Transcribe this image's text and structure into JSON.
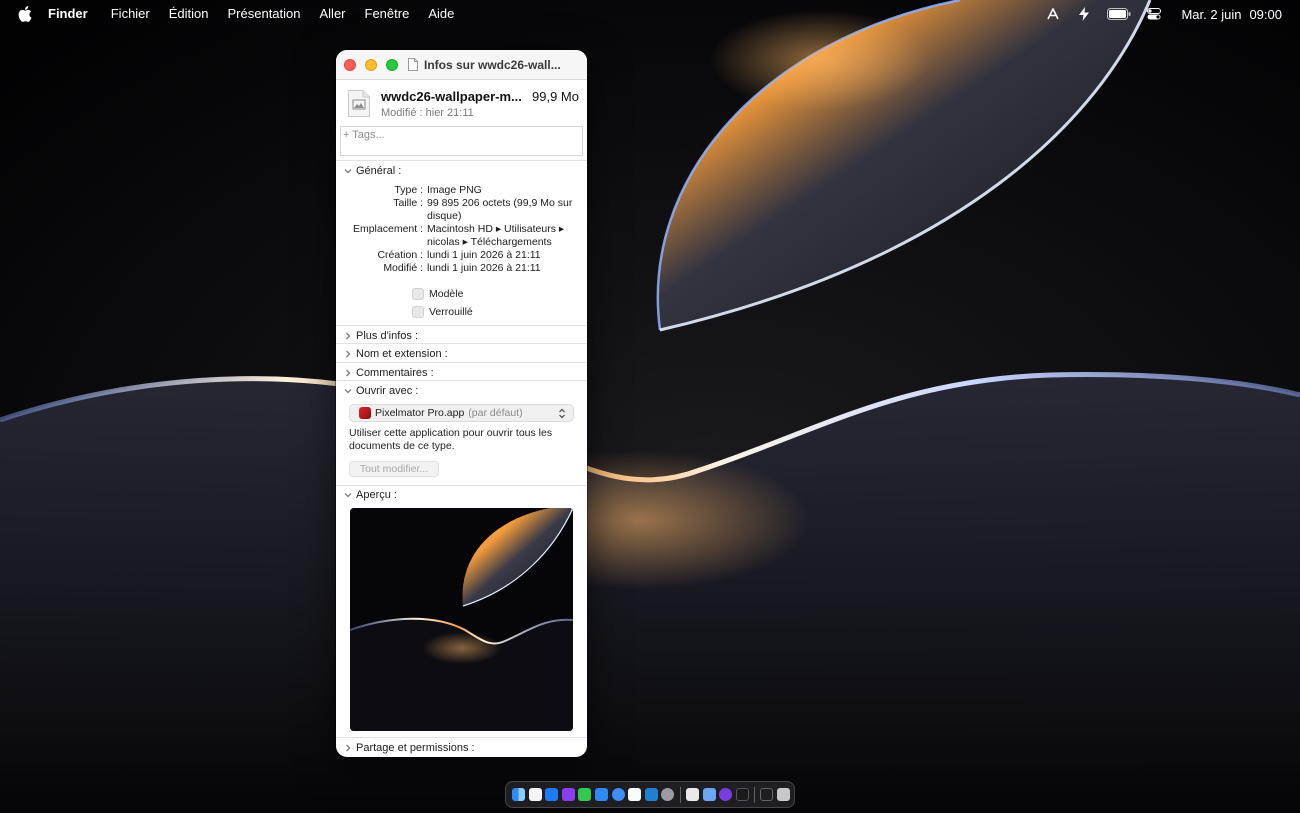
{
  "menubar": {
    "app_name": "Finder",
    "items": [
      "Fichier",
      "Édition",
      "Présentation",
      "Aller",
      "Fenêtre",
      "Aide"
    ],
    "status_icons": [
      "font-icon",
      "bolt-icon",
      "battery-icon",
      "control-center-icon"
    ],
    "date": "Mar. 2 juin",
    "time": "09:00"
  },
  "window": {
    "title": "Infos sur wwdc26-wall...",
    "file_name": "wwdc26-wallpaper-m...",
    "file_size": "99,9 Mo",
    "modified_short": "Modifié : hier 21:11",
    "tags_placeholder": "+ Tags...",
    "general": {
      "label": "Général :",
      "rows": [
        {
          "key": "Type :",
          "value": "Image PNG"
        },
        {
          "key": "Taille :",
          "value": "99 895 206 octets (99,9 Mo sur disque)"
        },
        {
          "key": "Emplacement :",
          "value": "Macintosh HD ▸ Utilisateurs ▸ nicolas ▸ Téléchargements"
        },
        {
          "key": "Création :",
          "value": "lundi 1 juin 2026 à 21:11"
        },
        {
          "key": "Modifié :",
          "value": "lundi 1 juin 2026 à 21:11"
        }
      ],
      "checkbox_template": "Modèle",
      "checkbox_locked": "Verrouillé"
    },
    "more_info": "Plus d'infos :",
    "name_extension": "Nom et extension :",
    "comments": "Commentaires :",
    "open_with": {
      "label": "Ouvrir avec :",
      "app": "Pixelmator Pro.app",
      "default_note": "(par défaut)",
      "hint": "Utiliser cette application pour ouvrir tous les documents de ce type.",
      "change_all": "Tout modifier..."
    },
    "preview_label": "Aperçu :",
    "sharing": "Partage et permissions :"
  },
  "dock": {
    "apps": [
      "finder-icon",
      "calendar-icon",
      "app-store-icon",
      "podcasts-icon",
      "messages-icon",
      "mail-icon",
      "safari-icon",
      "notes-icon",
      "vscode-icon",
      "settings-icon",
      "chatgpt-icon",
      "preview-icon",
      "github-icon",
      "terminal-icon",
      "downloads-icon",
      "trash-icon"
    ]
  },
  "colors": {
    "accent_close": "#ff5f57",
    "accent_min": "#febc2e",
    "accent_max": "#28c840"
  }
}
